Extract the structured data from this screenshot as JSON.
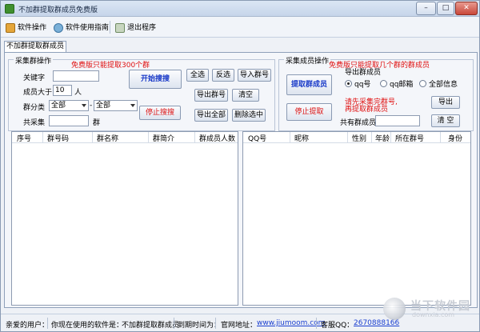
{
  "window": {
    "title": "不加群提取群成员免费版",
    "buttons": {
      "minimize": "–",
      "maximize": "□",
      "close": "✕"
    }
  },
  "menubar": {
    "items": [
      {
        "label": "软件操作",
        "icon": "software-icon"
      },
      {
        "label": "软件使用指南",
        "icon": "guide-icon"
      },
      {
        "label": "退出程序",
        "icon": "exit-icon"
      }
    ]
  },
  "tab": {
    "label": "不加群提取群成员"
  },
  "collect_group": {
    "title": "采集群操作",
    "notice": "免费版只能提取300个群",
    "keyword_label": "关键字",
    "keyword_value": "",
    "member_min_label": "成员大于",
    "member_min_value": "10",
    "member_unit": "人",
    "category_label": "群分类",
    "category_value_1": "全部",
    "category_dash": "-",
    "category_value_2": "全部",
    "total_label": "共采集",
    "total_value": "",
    "total_unit": "群",
    "start_button": "开始搜搜",
    "stop_button": "停止搜搜",
    "select_all": "全选",
    "invert": "反选",
    "import_groups": "导入群号",
    "export_groups": "导出群号",
    "clear": "清空",
    "export_all": "导出全部",
    "delete_selected": "删除选中"
  },
  "collect_members": {
    "title": "采集成员操作",
    "notice": "免费版只能提取几个群的群成员",
    "extract_button": "提取群成员",
    "stop_button": "停止提取",
    "export_title": "导出群成员",
    "options": [
      "qq号",
      "qq邮箱",
      "全部信息"
    ],
    "selected_option": 0,
    "warn_line1": "请先采集完群号,",
    "warn_line2": "再提取群成员",
    "export_button": "导出",
    "total_label": "共有群成员",
    "total_value": "",
    "clear_button": "清 空"
  },
  "groups_table": {
    "columns": [
      "序号",
      "群号码",
      "群名称",
      "群简介",
      "群成员人数"
    ]
  },
  "members_table": {
    "columns": [
      "QQ号",
      "昵称",
      "性别",
      "年龄",
      "所在群号",
      "身份"
    ]
  },
  "statusbar": {
    "user_label": "亲爱的用户：",
    "software_label": "你现在使用的软件是：",
    "software_value": "不加群提取群成员",
    "expire_label": "到期时间为：",
    "site_label": "官网地址：",
    "site_value": "www.jiumoom.com",
    "qq_label": "客服QQ：",
    "qq_value": "2670888166"
  },
  "watermark": {
    "text": "当下软件园",
    "sub": "downxia.com"
  }
}
